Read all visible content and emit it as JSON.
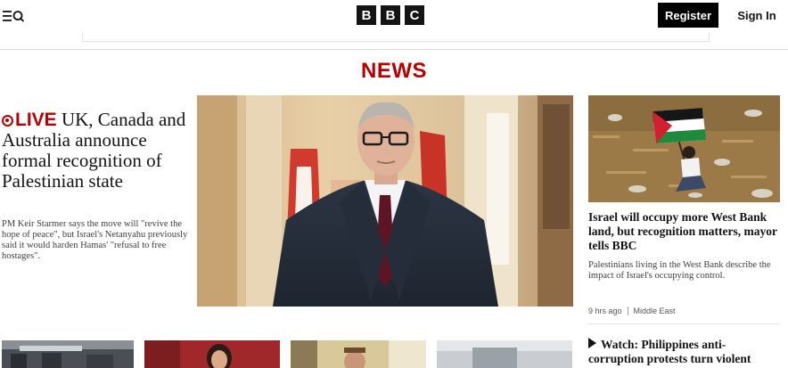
{
  "header": {
    "menu_icon": "menu-icon",
    "search_icon": "search-icon",
    "logo_letters": [
      "B",
      "B",
      "C"
    ],
    "register_label": "Register",
    "signin_label": "Sign In"
  },
  "section_title": "NEWS",
  "lead_story": {
    "live_label": "LIVE",
    "headline": "UK, Canada and Australia announce formal recognition of Palestinian state",
    "summary": "PM Keir Starmer says the move will \"revive the hope of peace\", but Israel's Netanyahu previously said it would harden Hamas' \"refusal to free hostages\"."
  },
  "side_story": {
    "headline": "Israel will occupy more West Bank land, but recognition matters, mayor tells BBC",
    "summary": "Palestinians living in the West Bank describe the impact of Israel's occupying control.",
    "time": "9 hrs ago",
    "tag": "Middle East"
  },
  "video_story": {
    "icon": "play-icon",
    "headline": "Watch: Philippines anti-corruption protests turn violent"
  },
  "colors": {
    "brand_red": "#b80000",
    "text": "#141414"
  }
}
